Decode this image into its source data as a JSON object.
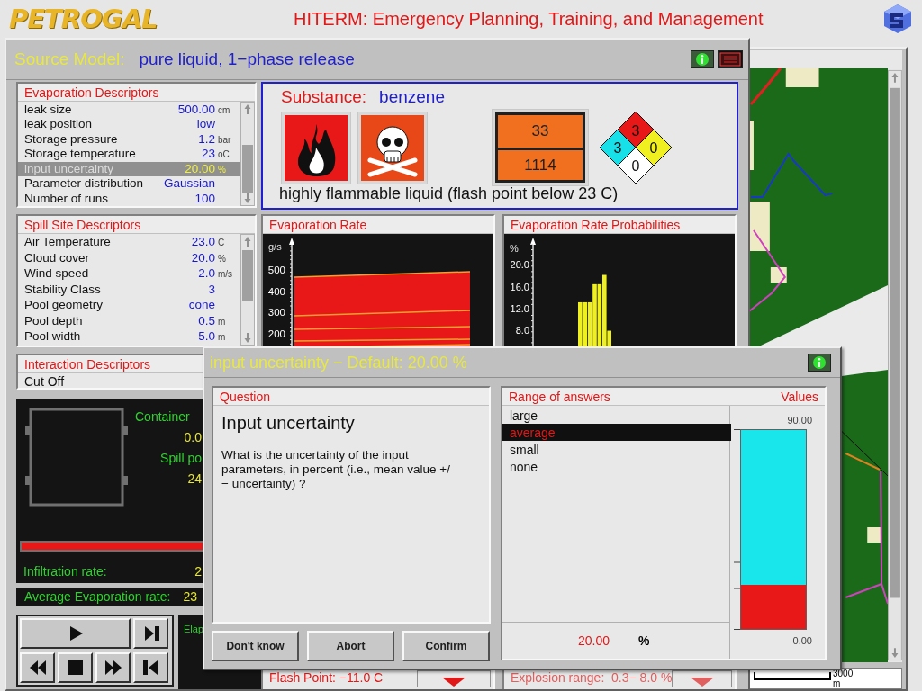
{
  "header": {
    "logo": "PETROGAL",
    "title": "HITERM: Emergency Planning, Training, and Management"
  },
  "main_window": {
    "label": "Source Model:",
    "model": "pure liquid, 1−phase release"
  },
  "evaporation_descriptors": {
    "title": "Evaporation Descriptors",
    "rows": [
      {
        "name": "leak size",
        "value": "500.00",
        "unit": "cm",
        "selected": false
      },
      {
        "name": "leak position",
        "value": "low",
        "selected": false
      },
      {
        "name": "Storage pressure",
        "value": "1.2",
        "unit": "bar",
        "selected": false
      },
      {
        "name": "Storage temperature",
        "value": "23",
        "unit": "oC",
        "selected": false
      },
      {
        "name": "input uncertainty",
        "value": "20.00",
        "unit": "%",
        "selected": true
      },
      {
        "name": "Parameter distribution",
        "value": "Gaussian",
        "selected": false
      },
      {
        "name": "Number of runs",
        "value": "100",
        "selected": false
      }
    ]
  },
  "substance": {
    "label": "Substance:",
    "name": "benzene",
    "hazard_code": "33",
    "un_number": "1114",
    "nfpa": {
      "flammability": "3",
      "health": "3",
      "reactivity": "0",
      "special": "0"
    },
    "description": "highly flammable liquid (flash point below 23 C)"
  },
  "spill_site_descriptors": {
    "title": "Spill Site Descriptors",
    "rows": [
      {
        "name": "Air Temperature",
        "value": "23.0",
        "unit": "C",
        "selected": false
      },
      {
        "name": "Cloud cover",
        "value": "20.0",
        "unit": "%",
        "selected": false
      },
      {
        "name": "Wind speed",
        "value": "2.0",
        "unit": "m/s",
        "selected": false
      },
      {
        "name": "Stability Class",
        "value": "3",
        "selected": false
      },
      {
        "name": "Pool geometry",
        "value": "cone",
        "selected": false
      },
      {
        "name": "Pool depth",
        "value": "0.5",
        "unit": "m",
        "selected": false
      },
      {
        "name": "Pool width",
        "value": "5.0",
        "unit": "m",
        "selected": false
      }
    ]
  },
  "evaporation_rate": {
    "title": "Evaporation Rate",
    "axis_label": "g/s",
    "y_ticks": [
      "500",
      "400",
      "300",
      "200"
    ]
  },
  "evaporation_probabilities": {
    "title": "Evaporation Rate Probabilities",
    "chart_data": {
      "type": "bar",
      "ylabel": "%",
      "categories": [
        null,
        null,
        null,
        null,
        null,
        null,
        null
      ],
      "ylim": [
        5,
        24
      ],
      "yticks": [
        {
          "value": 8,
          "label": "8.0"
        },
        {
          "value": 12,
          "label": "12.0"
        },
        {
          "value": 16,
          "label": "16.0"
        },
        {
          "value": 20,
          "label": "20.0"
        }
      ],
      "series": [
        {
          "color": "#f0f020",
          "values": [
            13.4,
            13.4,
            13.4,
            16.7,
            16.7,
            18.4,
            8.2
          ]
        }
      ]
    }
  },
  "interaction_descriptors": {
    "title": "Interaction Descriptors",
    "rows": [
      "Cut Off"
    ]
  },
  "spill_status": {
    "container_label": "Container",
    "container_value": "0.0",
    "spill_label": "Spill po",
    "spill_value": "24",
    "infiltration_label": "Infiltration rate:",
    "infiltration_value": "2"
  },
  "average_evaporation": {
    "label": "Average Evaporation rate:",
    "value": "23"
  },
  "elapsed": {
    "label": "Elap"
  },
  "bottom_panels": [
    {
      "text": "Flash Point: −11.0 C",
      "color": "#e01818"
    },
    {
      "text": "Explosion range:  0.3− 8.0 %",
      "color": "#e06060"
    }
  ],
  "map": {
    "scale": "3000",
    "scale_unit": "m"
  },
  "dialog": {
    "title": "input uncertainty − Default: 20.00 %",
    "question_header": "Question",
    "question_title": "Input uncertainty",
    "question_text": "What is the uncertainty of the input parameters, in percent (i.e., mean value +/− uncertainty) ?",
    "buttons": [
      "Don't know",
      "Abort",
      "Confirm"
    ],
    "answers_header": "Range of answers",
    "values_header": "Values",
    "answers": [
      {
        "label": "large",
        "selected": false
      },
      {
        "label": "average",
        "selected": true
      },
      {
        "label": "small",
        "selected": false
      },
      {
        "label": "none",
        "selected": false
      }
    ],
    "scale_max": "90.00",
    "scale_min": "0.00",
    "level": 0.22,
    "value": "20.00",
    "unit": "%"
  }
}
